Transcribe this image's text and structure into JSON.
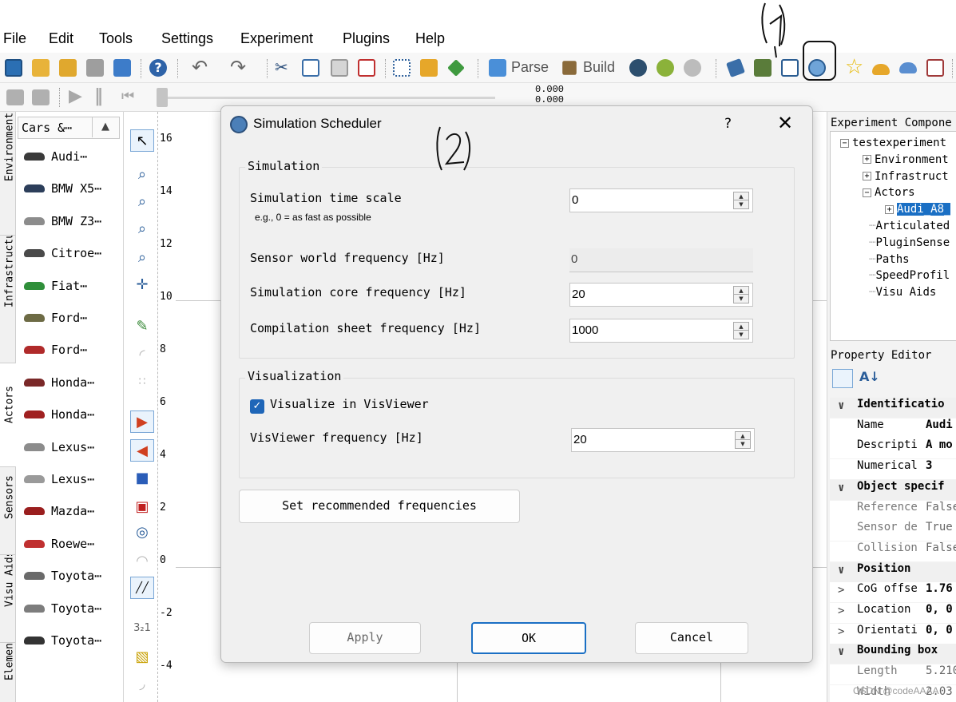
{
  "menu": [
    "File",
    "Edit",
    "Tools",
    "Settings",
    "Experiment",
    "Plugins",
    "Help"
  ],
  "toolbar": {
    "parse_label": "Parse",
    "build_label": "Build"
  },
  "simbar": {
    "readout_top": "0.000",
    "readout_bottom": "0.000"
  },
  "left_tabs": [
    "Environment",
    "Infrastructure",
    "Actors",
    "Sensors",
    "Visu Aids",
    "Elements"
  ],
  "carlist": {
    "header": "Cars &⋯",
    "items": [
      {
        "label": "Audi⋯",
        "color": "#3a3a3a"
      },
      {
        "label": "BMW X5⋯",
        "color": "#2c3e5a"
      },
      {
        "label": "BMW Z3⋯",
        "color": "#8c8c8c"
      },
      {
        "label": "Citroe⋯",
        "color": "#4a4a4a"
      },
      {
        "label": "Fiat⋯",
        "color": "#2f8f3a"
      },
      {
        "label": "Ford⋯",
        "color": "#6d6b45"
      },
      {
        "label": "Ford⋯",
        "color": "#b02a2a"
      },
      {
        "label": "Honda⋯",
        "color": "#7a2828"
      },
      {
        "label": "Honda⋯",
        "color": "#a02020"
      },
      {
        "label": "Lexus⋯",
        "color": "#8c8c8c"
      },
      {
        "label": "Lexus⋯",
        "color": "#9a9a9a"
      },
      {
        "label": "Mazda⋯",
        "color": "#9a1e1e"
      },
      {
        "label": "Roewe⋯",
        "color": "#c03030"
      },
      {
        "label": "Toyota⋯",
        "color": "#6a6a6a"
      },
      {
        "label": "Toyota⋯",
        "color": "#7d7d7d"
      },
      {
        "label": "Toyota⋯",
        "color": "#333333"
      }
    ]
  },
  "ruler": [
    "16",
    "14",
    "12",
    "10",
    "8",
    "6",
    "4",
    "2",
    "0",
    "-2",
    "-4"
  ],
  "experiment_panel": {
    "title": "Experiment Compone",
    "tree": [
      {
        "label": "testexperiment",
        "box": "−"
      },
      {
        "label": "Environment",
        "box": "+"
      },
      {
        "label": "Infrastruct",
        "box": "+"
      },
      {
        "label": "Actors",
        "box": "−"
      },
      {
        "label": "Audi_A8_",
        "box": "+",
        "selected": true
      },
      {
        "label": "Articulated",
        "box": ""
      },
      {
        "label": "PluginSense",
        "box": ""
      },
      {
        "label": "Paths",
        "box": ""
      },
      {
        "label": "SpeedProfil",
        "box": ""
      },
      {
        "label": "Visu Aids",
        "box": ""
      }
    ]
  },
  "property_editor": {
    "title": "Property Editor",
    "rows": [
      {
        "type": "cat",
        "chev": "∨",
        "key": "Identificatio",
        "val": ""
      },
      {
        "type": "sub",
        "chev": "",
        "key": "Name",
        "val": "Audi"
      },
      {
        "type": "sub",
        "chev": "",
        "key": "Descripti",
        "val": "A mo"
      },
      {
        "type": "sub",
        "chev": "",
        "key": "Numerical",
        "val": "3"
      },
      {
        "type": "cat",
        "chev": "∨",
        "key": "Object specif",
        "val": ""
      },
      {
        "type": "subplain",
        "chev": "",
        "key": "Reference",
        "val": "False"
      },
      {
        "type": "subplain",
        "chev": "",
        "key": "Sensor de",
        "val": "True"
      },
      {
        "type": "subplain",
        "chev": "",
        "key": "Collision",
        "val": "False"
      },
      {
        "type": "cat",
        "chev": "∨",
        "key": "Position",
        "val": ""
      },
      {
        "type": "sub",
        "chev": ">",
        "key": "CoG offse",
        "val": "1.76"
      },
      {
        "type": "sub",
        "chev": ">",
        "key": "Location",
        "val": "0, 0"
      },
      {
        "type": "sub",
        "chev": ">",
        "key": "Orientati",
        "val": "0, 0"
      },
      {
        "type": "cat",
        "chev": "∨",
        "key": "Bounding box",
        "val": ""
      },
      {
        "type": "subplain",
        "chev": "",
        "key": "Length",
        "val": "5.210"
      },
      {
        "type": "subplain",
        "chev": "",
        "key": "Width",
        "val": "2.03"
      }
    ]
  },
  "dialog": {
    "title": "Simulation Scheduler",
    "help": "?",
    "close": "✕",
    "simulation_group": "Simulation",
    "time_scale_label": "Simulation time scale",
    "time_scale_hint": "e.g., 0 = as fast as possible",
    "time_scale_value": "0",
    "sensor_freq_label": "Sensor world frequency [Hz]",
    "sensor_freq_value": "0",
    "core_freq_label": "Simulation core frequency [Hz]",
    "core_freq_value": "20",
    "compilation_freq_label": "Compilation sheet frequency [Hz]",
    "compilation_freq_value": "1000",
    "visualization_group": "Visualization",
    "visualize_label": "Visualize in VisViewer",
    "visualize_checked": true,
    "visviewer_freq_label": "VisViewer frequency [Hz]",
    "visviewer_freq_value": "20",
    "recommended_button": "Set recommended frequencies",
    "apply_button": "Apply",
    "ok_button": "OK",
    "cancel_button": "Cancel"
  },
  "annotations": {
    "one": "1",
    "two": "2"
  },
  "watermark": "CSDN @codeAAAA",
  "colors": {
    "accent": "#1a6fc4",
    "checkbox": "#1f66b8",
    "selection": "#1a6fc4"
  }
}
